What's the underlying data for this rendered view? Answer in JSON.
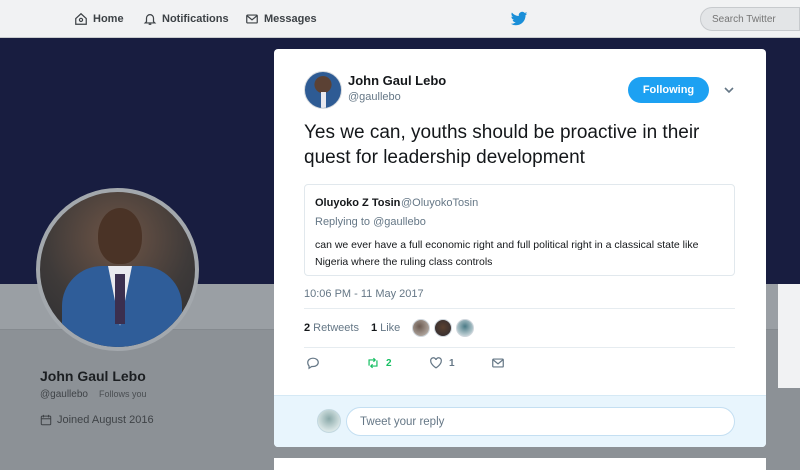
{
  "nav": {
    "home": "Home",
    "notifications": "Notifications",
    "messages": "Messages",
    "search_placeholder": "Search Twitter"
  },
  "profile": {
    "name": "John Gaul Lebo",
    "handle": "@gaullebo",
    "follows_you": "Follows you",
    "joined": "Joined August 2016"
  },
  "tweet": {
    "author_name": "John Gaul Lebo",
    "author_handle": "@gaullebo",
    "follow_label": "Following",
    "text": "Yes we can, youths should be proactive in their quest for leadership development",
    "quoted": {
      "name": "Oluyoko Z Tosin",
      "handle": "@OluyokoTosin",
      "replying_to": "Replying to @gaullebo",
      "text": "can we ever have a full economic right and full political right in a classical state like Nigeria where the ruling class controls"
    },
    "timestamp": "10:06 PM - 11 May 2017",
    "retweets_count": "2",
    "retweets_label": "Retweets",
    "likes_count": "1",
    "likes_label": "Like",
    "action_retweet_count": "2",
    "action_like_count": "1",
    "reply_placeholder": "Tweet your reply"
  },
  "colors": {
    "accent": "#1da1f2",
    "retweet_green": "#17bf63",
    "banner": "#181d40"
  }
}
